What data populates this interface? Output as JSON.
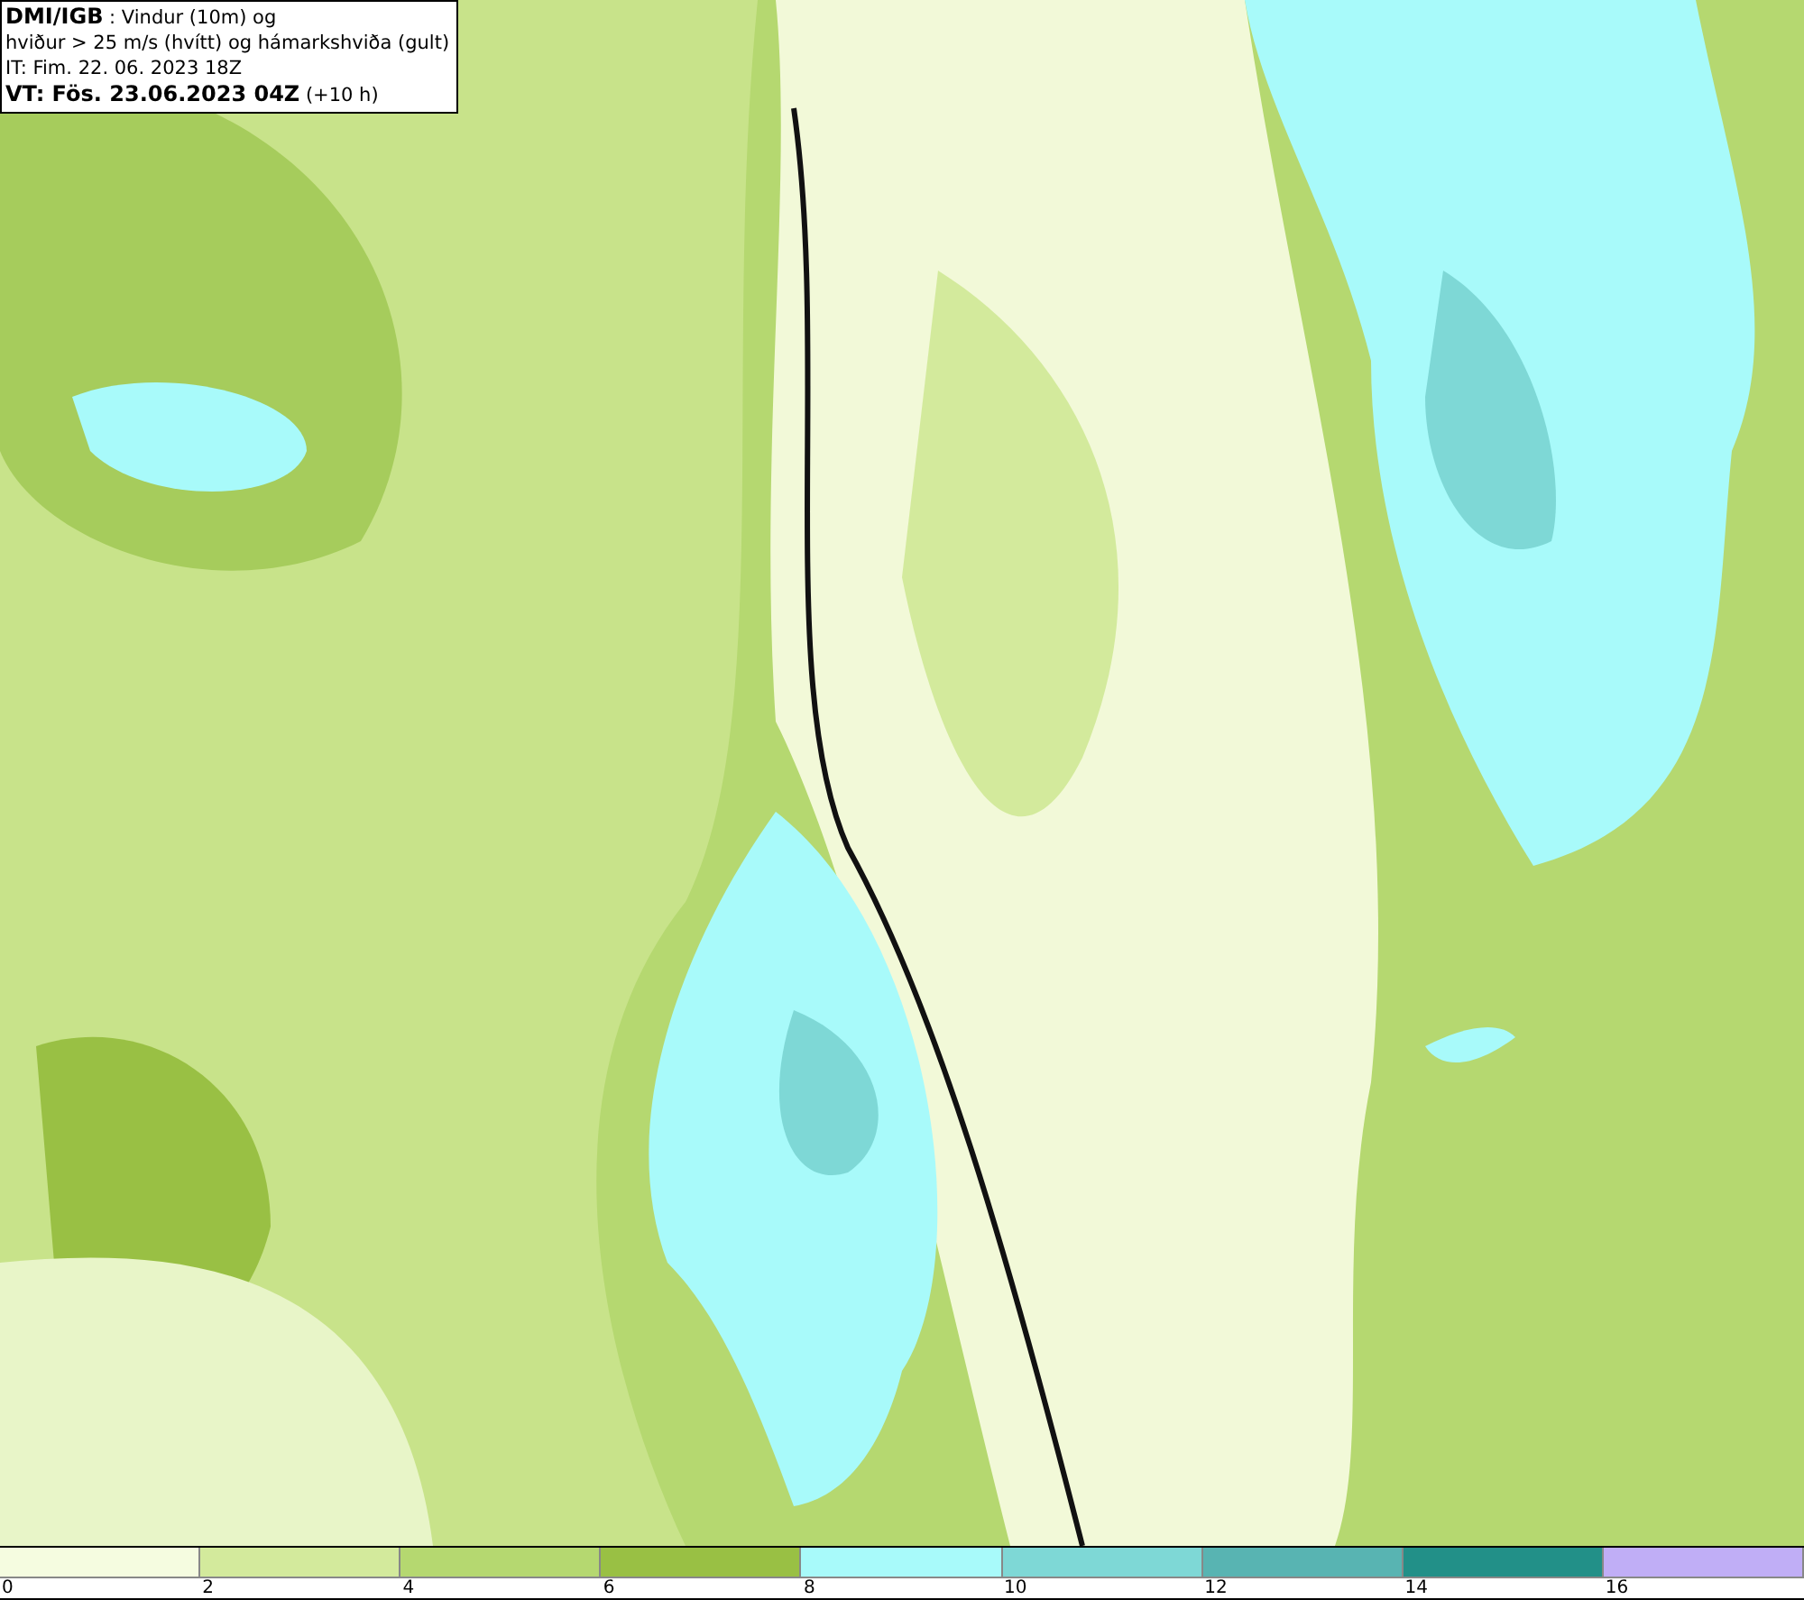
{
  "header": {
    "lines": [
      "**DMI/IGB** : Vindur (10m) og",
      "hviður > 25 m/s (hvítt) og hámarkshviða (gult)",
      "IT: Fim. 22. 06. 2023 18Z",
      "**VT: Fös. 23.06.2023 04Z** (+10 h)"
    ]
  },
  "legend": {
    "bins": [
      {
        "color": "#f5fce0",
        "tick": "0"
      },
      {
        "color": "#d3ea9c",
        "tick": "2"
      },
      {
        "color": "#b5d870",
        "tick": "4"
      },
      {
        "color": "#99c044",
        "tick": "6"
      },
      {
        "color": "#a8fafa",
        "tick": "8"
      },
      {
        "color": "#7ed8d6",
        "tick": "10"
      },
      {
        "color": "#58b4b2",
        "tick": "12"
      },
      {
        "color": "#229088",
        "tick": "14"
      },
      {
        "color": "#c0aef6",
        "tick": "16"
      }
    ]
  }
}
